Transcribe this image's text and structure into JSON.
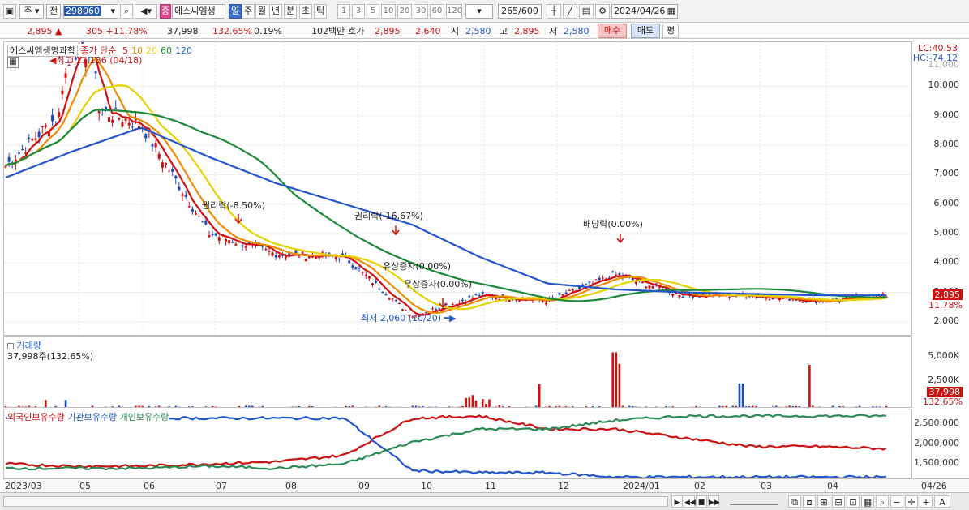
{
  "toolbar": {
    "type_label": "주",
    "period_label": "전",
    "code": "298060",
    "badge": "증",
    "stock_name": "에스씨엠생",
    "periods": [
      "일",
      "주",
      "월",
      "년",
      "분",
      "초",
      "틱"
    ],
    "nums": [
      "1",
      "3",
      "5",
      "10",
      "20",
      "30",
      "60",
      "120"
    ],
    "count": "265",
    "count_total": "/600",
    "date": "2024/04/26"
  },
  "quote": {
    "price": "2,895",
    "change": "305",
    "change_pct": "+11.78%",
    "volume": "37,998",
    "vol_ratio": "132.65%",
    "turnover": "0.19%",
    "amount": "102백만",
    "bid_label": "호가",
    "bid": "2,895",
    "ask": "2,640",
    "open_label": "시",
    "open": "2,580",
    "high_label": "고",
    "high": "2,895",
    "low_label": "저",
    "low": "2,580",
    "buy": "매수",
    "sell": "매도",
    "avg": "평"
  },
  "price_pane": {
    "legend_name": "에스씨엠생명과학",
    "legend_type": "종가 단순",
    "ma_labels": [
      "5",
      "10",
      "20",
      "60",
      "120"
    ],
    "ma_colors": [
      "#d01010",
      "#f08c00",
      "#e6d200",
      "#1a8a3a",
      "#2255cc"
    ],
    "lc": "LC:40.53",
    "hc": "HC:-74.12",
    "yaxis": [
      "10,000",
      "9,000",
      "8,000",
      "7,000",
      "6,000",
      "5,000",
      "4,000",
      "3,000",
      "2,000"
    ],
    "y_partial": "11,000",
    "cur_price": "2,895",
    "cur_pct": "11.78%",
    "annotations": {
      "high": "최고 11,186 (04/18)",
      "low": "최저 2,060 (10/20)",
      "rights1": "권리락(-8.50%)",
      "rights2": "권리락(-16,67%)",
      "capinc1": "유상증자(0.00%)",
      "capinc2": "무상증자(0.00%)",
      "div": "배당락(0.00%)"
    }
  },
  "volume_pane": {
    "title": "거래량",
    "value": "37,998주(132.65%)",
    "yaxis": [
      "5,000K",
      "2,500K"
    ],
    "cur": "37,998",
    "cur_pct": "132.65%"
  },
  "holders_pane": {
    "legend": [
      "외국인보유수량",
      "기관보유수량",
      "개인보유수량"
    ],
    "colors": [
      "#cc1111",
      "#2255cc",
      "#2a8a55"
    ],
    "yaxis": [
      "2,500,000",
      "2,000,000",
      "1,500,000"
    ]
  },
  "date_axis": [
    "2023/03",
    "05",
    "06",
    "07",
    "08",
    "09",
    "10",
    "11",
    "12",
    "2024/01",
    "02",
    "03",
    "04",
    "04/26"
  ],
  "chart_data": {
    "type": "line",
    "title": "에스씨엠생명과학",
    "price_ylim": [
      1500,
      11500
    ],
    "x": [
      "2023/03",
      "05",
      "06",
      "07",
      "08",
      "09",
      "10",
      "11",
      "12",
      "2024/01",
      "02",
      "03",
      "04",
      "04/26"
    ],
    "price_close_approx": [
      7300,
      9500,
      8700,
      5000,
      4300,
      4200,
      2200,
      2900,
      2700,
      3600,
      2900,
      2900,
      2700,
      2895
    ],
    "ma_120": [
      6900,
      7800,
      8600,
      7600,
      6700,
      6000,
      5300,
      4200,
      3300,
      3100,
      3000,
      2950,
      2900,
      2900
    ],
    "volume_spikes_k": [
      {
        "x": "10/20",
        "v": 2700
      },
      {
        "x": "12/28",
        "v": 6000
      },
      {
        "x": "02/20",
        "v": 4500
      }
    ],
    "series_holders": [
      {
        "name": "외국인보유수량",
        "values": [
          1500000,
          1450000,
          1450000,
          1500000,
          1550000,
          1700000,
          2550000,
          2600000,
          2300000,
          2300000,
          2100000,
          1900000,
          1900000,
          1850000
        ]
      },
      {
        "name": "기관보유수량",
        "values": [
          2550000,
          2600000,
          2550000,
          2550000,
          2550000,
          2550000,
          1350000,
          1300000,
          1300000,
          1200000,
          1200000,
          1200000,
          1200000,
          1200000
        ]
      },
      {
        "name": "개인보유수량",
        "values": [
          1400000,
          1400000,
          1400000,
          1450000,
          1400000,
          1500000,
          2000000,
          2300000,
          2300000,
          2500000,
          2600000,
          2600000,
          2600000,
          2600000
        ]
      }
    ]
  }
}
